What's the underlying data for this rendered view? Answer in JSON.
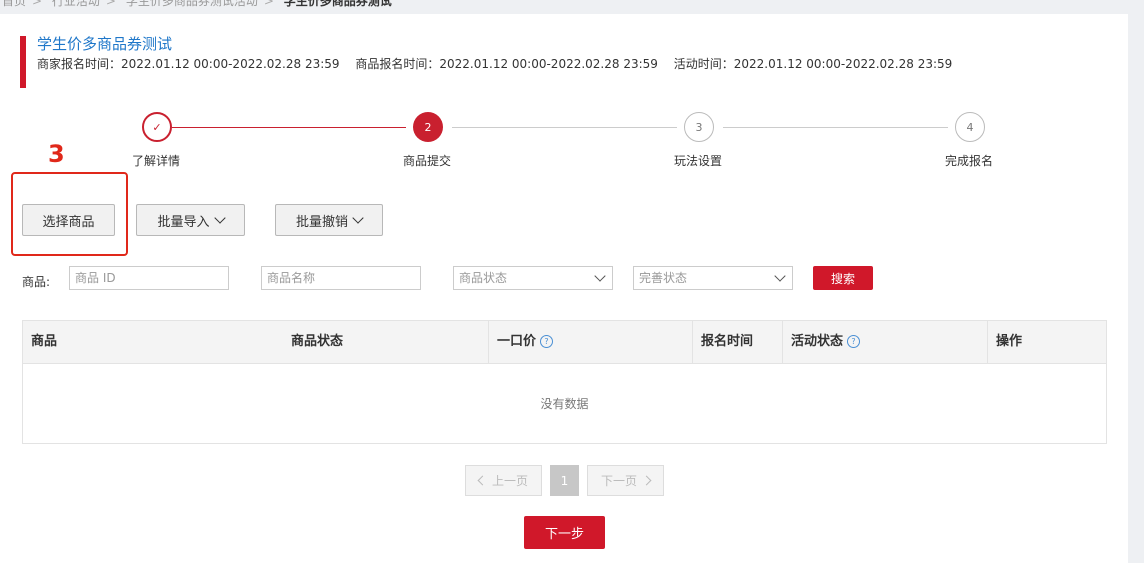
{
  "breadcrumb": [
    "首页",
    "行业活动",
    "学生价多商品券测试活动",
    "学生价多商品券测试"
  ],
  "title": "学生价多商品券测试",
  "times": [
    "商家报名时间：2022.01.12 00:00-2022.02.28 23:59",
    "商品报名时间：2022.01.12 00:00-2022.02.28 23:59",
    "活动时间：2022.01.12 00:00-2022.02.28 23:59"
  ],
  "steps": [
    {
      "number": "✓",
      "label": "了解详情",
      "state": "done"
    },
    {
      "number": "2",
      "label": "商品提交",
      "state": "active"
    },
    {
      "number": "3",
      "label": "玩法设置",
      "state": "pending"
    },
    {
      "number": "4",
      "label": "完成报名",
      "state": "pending"
    }
  ],
  "annotation": {
    "number": "3"
  },
  "actions": {
    "select": "选择商品",
    "batch_import": "批量导入",
    "batch_revoke": "批量撤销"
  },
  "filters": {
    "label": "商品:",
    "id_placeholder": "商品 ID",
    "name_placeholder": "商品名称",
    "status_placeholder": "商品状态",
    "complete_placeholder": "完善状态",
    "search": "搜索"
  },
  "table": {
    "columns": [
      "商品",
      "商品状态",
      "一口价",
      "报名时间",
      "活动状态",
      "操作"
    ],
    "empty": "没有数据"
  },
  "pagination": {
    "prev": "上一页",
    "page": "1",
    "next": "下一页"
  },
  "next_step": "下一步",
  "colors": {
    "primary": "#d0182a",
    "link": "#1f77c9"
  }
}
